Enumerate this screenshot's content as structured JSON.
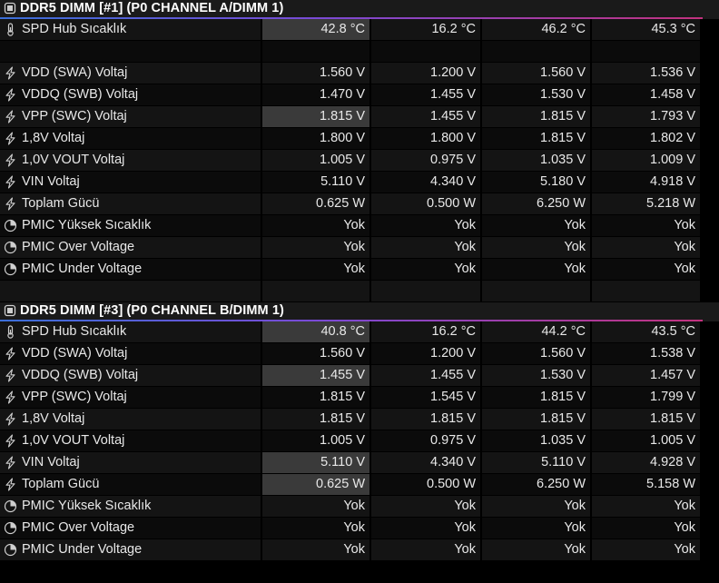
{
  "sections": [
    {
      "title": "DDR5 DIMM [#1] (P0 CHANNEL A/DIMM 1)",
      "rows": [
        {
          "icon": "thermometer-icon",
          "label": "SPD Hub Sıcaklık",
          "values": [
            "42.8 °C",
            "16.2 °C",
            "46.2 °C",
            "45.3 °C"
          ],
          "highlight": true
        },
        {
          "spacer": true
        },
        {
          "icon": "voltage-icon",
          "label": "VDD (SWA) Voltaj",
          "values": [
            "1.560 V",
            "1.200 V",
            "1.560 V",
            "1.536 V"
          ]
        },
        {
          "icon": "voltage-icon",
          "label": "VDDQ (SWB) Voltaj",
          "values": [
            "1.470 V",
            "1.455 V",
            "1.530 V",
            "1.458 V"
          ]
        },
        {
          "icon": "voltage-icon",
          "label": "VPP (SWC) Voltaj",
          "values": [
            "1.815 V",
            "1.455 V",
            "1.815 V",
            "1.793 V"
          ],
          "highlight": true
        },
        {
          "icon": "voltage-icon",
          "label": "1,8V Voltaj",
          "values": [
            "1.800 V",
            "1.800 V",
            "1.815 V",
            "1.802 V"
          ]
        },
        {
          "icon": "voltage-icon",
          "label": "1,0V VOUT Voltaj",
          "values": [
            "1.005 V",
            "0.975 V",
            "1.035 V",
            "1.009 V"
          ]
        },
        {
          "icon": "voltage-icon",
          "label": "VIN Voltaj",
          "values": [
            "5.110 V",
            "4.340 V",
            "5.180 V",
            "4.918 V"
          ]
        },
        {
          "icon": "power-icon",
          "label": "Toplam Gücü",
          "values": [
            "0.625 W",
            "0.500 W",
            "6.250 W",
            "5.218 W"
          ]
        },
        {
          "icon": "clock-icon",
          "label": "PMIC Yüksek Sıcaklık",
          "values": [
            "Yok",
            "Yok",
            "Yok",
            "Yok"
          ]
        },
        {
          "icon": "clock-icon",
          "label": "PMIC Over Voltage",
          "values": [
            "Yok",
            "Yok",
            "Yok",
            "Yok"
          ]
        },
        {
          "icon": "clock-icon",
          "label": "PMIC Under Voltage",
          "values": [
            "Yok",
            "Yok",
            "Yok",
            "Yok"
          ]
        }
      ]
    },
    {
      "title": "DDR5 DIMM [#3] (P0 CHANNEL B/DIMM 1)",
      "rows": [
        {
          "icon": "thermometer-icon",
          "label": "SPD Hub Sıcaklık",
          "values": [
            "40.8 °C",
            "16.2 °C",
            "44.2 °C",
            "43.5 °C"
          ],
          "highlight": true
        },
        {
          "icon": "voltage-icon",
          "label": "VDD (SWA) Voltaj",
          "values": [
            "1.560 V",
            "1.200 V",
            "1.560 V",
            "1.538 V"
          ]
        },
        {
          "icon": "voltage-icon",
          "label": "VDDQ (SWB) Voltaj",
          "values": [
            "1.455 V",
            "1.455 V",
            "1.530 V",
            "1.457 V"
          ],
          "highlight": true
        },
        {
          "icon": "voltage-icon",
          "label": "VPP (SWC) Voltaj",
          "values": [
            "1.815 V",
            "1.545 V",
            "1.815 V",
            "1.799 V"
          ]
        },
        {
          "icon": "voltage-icon",
          "label": "1,8V Voltaj",
          "values": [
            "1.815 V",
            "1.815 V",
            "1.815 V",
            "1.815 V"
          ]
        },
        {
          "icon": "voltage-icon",
          "label": "1,0V VOUT Voltaj",
          "values": [
            "1.005 V",
            "0.975 V",
            "1.035 V",
            "1.005 V"
          ]
        },
        {
          "icon": "voltage-icon",
          "label": "VIN Voltaj",
          "values": [
            "5.110 V",
            "4.340 V",
            "5.110 V",
            "4.928 V"
          ],
          "highlight": true
        },
        {
          "icon": "power-icon",
          "label": "Toplam Gücü",
          "values": [
            "0.625 W",
            "0.500 W",
            "6.250 W",
            "5.158 W"
          ],
          "highlight": true
        },
        {
          "icon": "clock-icon",
          "label": "PMIC Yüksek Sıcaklık",
          "values": [
            "Yok",
            "Yok",
            "Yok",
            "Yok"
          ]
        },
        {
          "icon": "clock-icon",
          "label": "PMIC Over Voltage",
          "values": [
            "Yok",
            "Yok",
            "Yok",
            "Yok"
          ]
        },
        {
          "icon": "clock-icon",
          "label": "PMIC Under Voltage",
          "values": [
            "Yok",
            "Yok",
            "Yok",
            "Yok"
          ]
        }
      ]
    }
  ],
  "colors": {
    "accent_gradient_start": "#3b6fd8",
    "accent_gradient_mid": "#7a4ad6",
    "accent_gradient_end": "#c2327e",
    "highlight_cell": "#3a3a3a",
    "row_dark": "#0b0b0b",
    "row_light": "#141414"
  }
}
